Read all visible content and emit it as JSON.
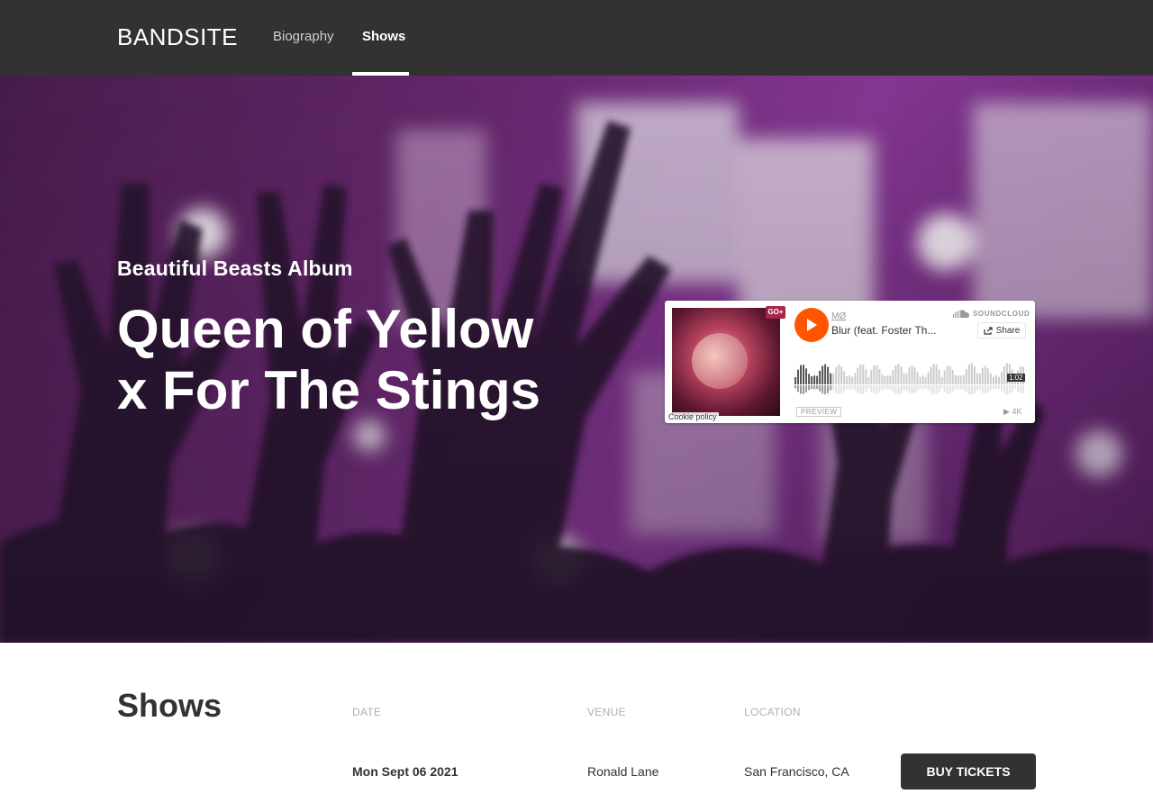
{
  "header": {
    "logo": "BANDSITE",
    "nav": [
      {
        "label": "Biography",
        "active": false
      },
      {
        "label": "Shows",
        "active": true
      }
    ]
  },
  "hero": {
    "album_label": "Beautiful Beasts Album",
    "title_line1": "Queen of Yellow",
    "title_line2": "x For The Stings"
  },
  "player": {
    "artist": "MØ",
    "track": "Blur (feat. Foster Th...",
    "brand": "SOUNDCLOUD",
    "share_label": "Share",
    "preview_label": "PREVIEW",
    "plays": "4K",
    "duration": "1:02",
    "cookie_label": "Cookie policy",
    "badge": "GO+",
    "play_color": "#ff5500",
    "progress_fraction": 0.16
  },
  "shows": {
    "title": "Shows",
    "columns": [
      "DATE",
      "VENUE",
      "LOCATION"
    ],
    "rows": [
      {
        "date": "Mon Sept 06 2021",
        "venue": "Ronald Lane",
        "location": "San Francisco, CA",
        "button": "BUY TICKETS"
      }
    ]
  },
  "colors": {
    "header_bg": "#323232",
    "text_dark": "#323232",
    "muted": "#afafaf",
    "hero_tint": "#8b3a9a"
  }
}
